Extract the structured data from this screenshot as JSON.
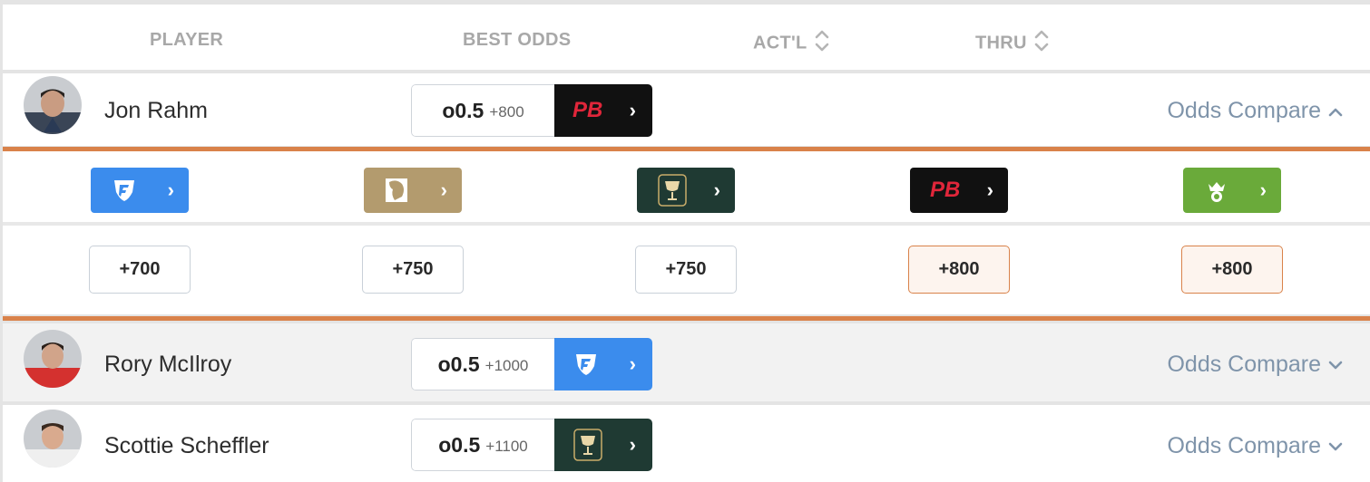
{
  "header": {
    "player": "PLAYER",
    "best_odds": "BEST ODDS",
    "actl": "ACT'L",
    "thru": "THRU"
  },
  "players": [
    {
      "name": "Jon Rahm",
      "line": "o0.5",
      "price": "+800",
      "book": "PB",
      "book_color": "#111111",
      "compare_label": "Odds Compare",
      "expanded": true
    },
    {
      "name": "Rory McIlroy",
      "line": "o0.5",
      "price": "+1000",
      "book": "fanduel-shield-icon",
      "book_color": "#3b8ced",
      "compare_label": "Odds Compare",
      "expanded": false
    },
    {
      "name": "Scottie Scheffler",
      "line": "o0.5",
      "price": "+1100",
      "book": "trophy-cup-icon",
      "book_color": "#1f3a33",
      "compare_label": "Odds Compare",
      "expanded": false
    }
  ],
  "compare_panel": {
    "books": [
      {
        "name": "fanduel-shield-icon",
        "color": "#3b8ced",
        "odds": "+700",
        "best": false
      },
      {
        "name": "lion-icon",
        "color": "#b39b6e",
        "odds": "+750",
        "best": false
      },
      {
        "name": "trophy-cup-icon",
        "color": "#1f3a33",
        "odds": "+750",
        "best": false
      },
      {
        "name": "PB",
        "color": "#111111",
        "odds": "+800",
        "best": true
      },
      {
        "name": "draftkings-crown-icon",
        "color": "#6aaa3a",
        "odds": "+800",
        "best": true
      }
    ]
  },
  "colors": {
    "accent": "#d9824a",
    "compare_link": "#7f94aa"
  }
}
